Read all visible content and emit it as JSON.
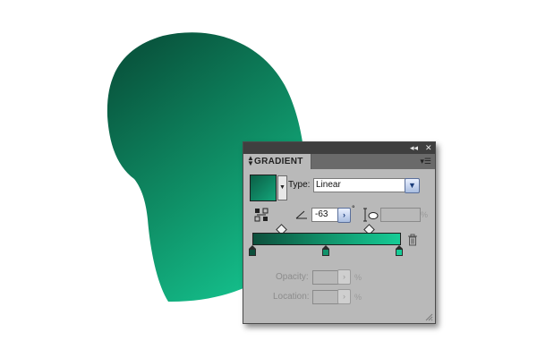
{
  "panel": {
    "title": "GRADIENT",
    "collapse_label": "◂◂",
    "close_label": "✕",
    "menu_label": "▾☰",
    "type_label": "Type:",
    "type_value": "Linear",
    "angle_value": "-63",
    "degree_symbol": "°",
    "percent_symbol": "%",
    "opacity_label": "Opacity:",
    "location_label": "Location:"
  },
  "gradient": {
    "stops": [
      {
        "color": "#0d4f3c",
        "location": 0
      },
      {
        "color": "#11936b",
        "location": 50
      },
      {
        "color": "#16cc96",
        "location": 100
      }
    ],
    "midpoints": [
      20,
      78
    ],
    "angle": -63,
    "type": "Linear"
  },
  "icons": {
    "reverse": "reverse-gradient-icon",
    "angle": "angle-icon",
    "aspect": "aspect-ratio-icon",
    "trash": "trash-icon",
    "dropdown": "chevron-down-icon",
    "stepper": "chevron-right-icon"
  },
  "colors": {
    "shape_dark": "#0b5f46",
    "shape_light": "#14c890",
    "panel_bg": "#b9b9b9",
    "titlebar": "#3f3f3f"
  }
}
